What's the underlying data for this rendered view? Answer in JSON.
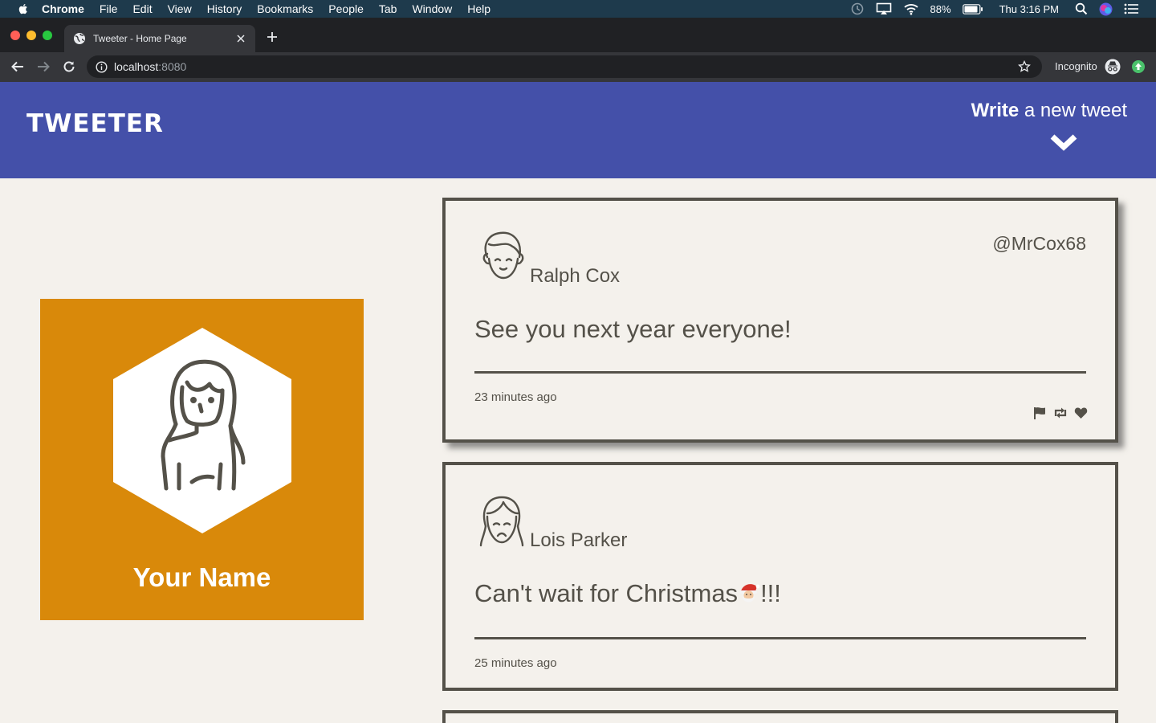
{
  "menubar": {
    "app_name": "Chrome",
    "menus": [
      "File",
      "Edit",
      "View",
      "History",
      "Bookmarks",
      "People",
      "Tab",
      "Window",
      "Help"
    ],
    "battery": "88%",
    "clock": "Thu 3:16 PM"
  },
  "browser": {
    "tab_title": "Tweeter - Home Page",
    "url_host": "localhost",
    "url_port": ":8080",
    "incognito_label": "Incognito"
  },
  "header": {
    "logo": "TWEETER",
    "compose_strong": "Write",
    "compose_rest": " a new tweet"
  },
  "profile": {
    "name": "Your Name",
    "color": "#d9890a"
  },
  "tweets": [
    {
      "name": "Ralph Cox",
      "handle": "@MrCox68",
      "text": "See you next year everyone!",
      "time": "23 minutes ago"
    },
    {
      "name": "Lois Parker",
      "handle": "",
      "text_before": "Can't wait for Christmas",
      "text_after": "!!!",
      "time": "25 minutes ago"
    }
  ],
  "colors": {
    "header_bg": "#4450a9",
    "page_bg": "#f4f1ec",
    "ink": "#545149"
  },
  "icons": [
    "apple-icon",
    "flag-icon",
    "retweet-icon",
    "heart-icon",
    "chevron-down-icon",
    "santa-emoji"
  ]
}
